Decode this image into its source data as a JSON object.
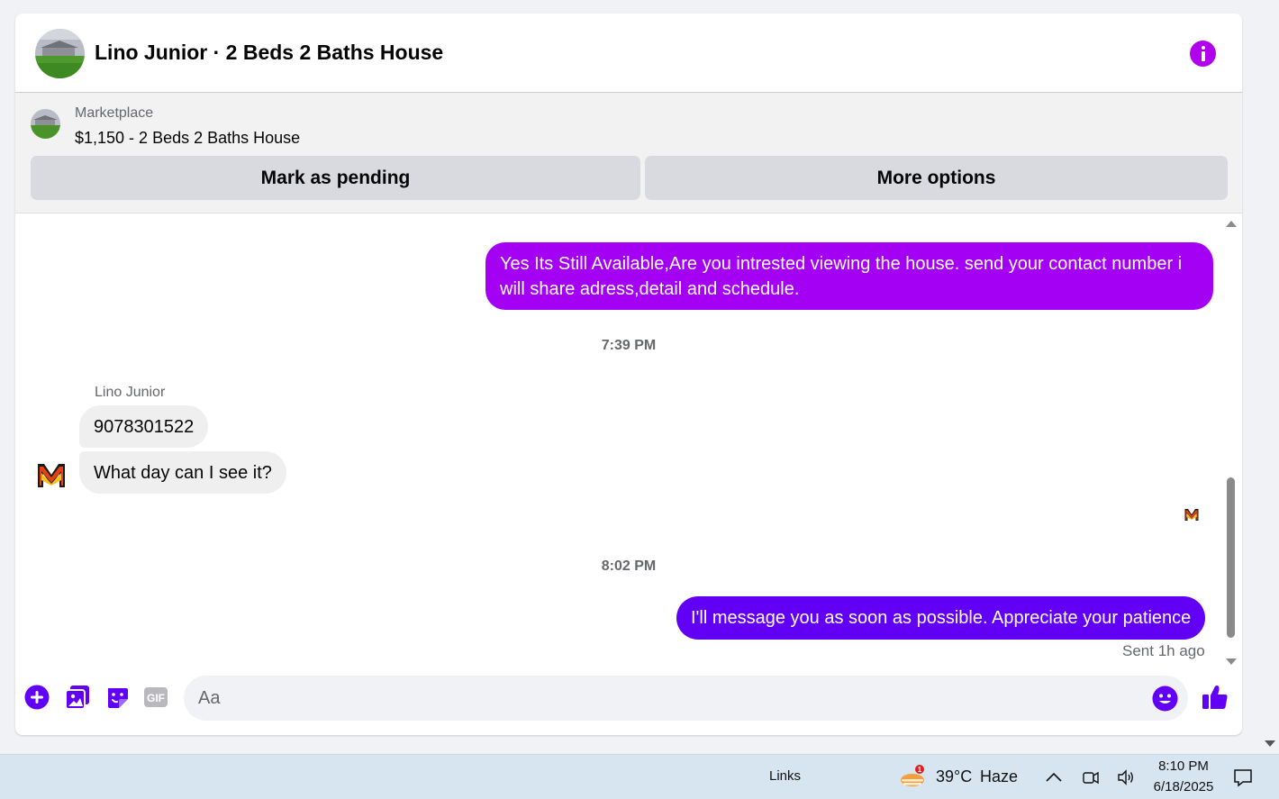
{
  "header": {
    "title": "Lino Junior · 2 Beds 2 Baths House",
    "avatar_icon": "house-photo",
    "info_icon": "info-icon",
    "accent_color": "#b100ec"
  },
  "listing": {
    "source": "Marketplace",
    "title": "$1,150 - 2 Beds 2 Baths House",
    "buttons": {
      "pending": "Mark as pending",
      "more": "More options"
    }
  },
  "messages": {
    "outgoing_1": "Yes Its Still Available,Are you intrested viewing the house. send your contact number i will share adress,detail and schedule.",
    "timestamp_1": "7:39 PM",
    "sender_name": "Lino Junior",
    "incoming_1": "9078301522",
    "incoming_2": "What day can I see it?",
    "timestamp_2": "8:02 PM",
    "outgoing_2": "I'll message you as soon as possible. Appreciate your patience",
    "sent_status": "Sent 1h ago",
    "outgoing_color_1": "#a400f4",
    "outgoing_color_2": "#6200f5"
  },
  "composer": {
    "placeholder": "Aa",
    "value": "",
    "icons": [
      "plus-icon",
      "photo-icon",
      "sticker-icon",
      "gif-icon",
      "emoji-icon",
      "thumbs-up-icon"
    ]
  },
  "taskbar": {
    "links_label": "Links",
    "weather_badge": "1",
    "temperature": "39°C",
    "condition": "Haze",
    "time": "8:10 PM",
    "date": "6/18/2025"
  }
}
